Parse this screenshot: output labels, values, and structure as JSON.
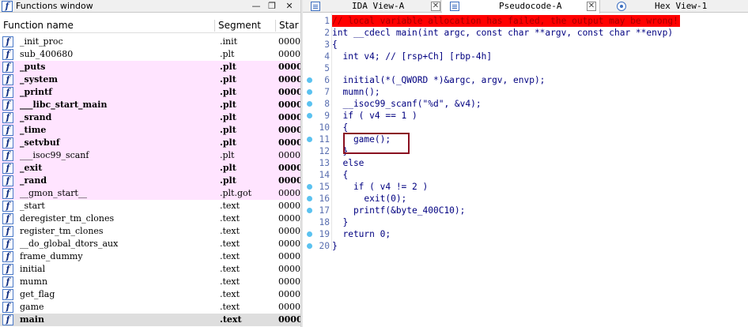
{
  "functions_window": {
    "title": "Functions window",
    "controls": {
      "close": "✕",
      "restore": "❐",
      "minimize": "—"
    },
    "columns": {
      "name": "Function name",
      "segment": "Segment",
      "start": "Star"
    },
    "rows": [
      {
        "name": "_init_proc",
        "segment": ".init",
        "start": "0000",
        "style": "normal"
      },
      {
        "name": "sub_400680",
        "segment": ".plt",
        "start": "0000",
        "style": "normal"
      },
      {
        "name": "_puts",
        "segment": ".plt",
        "start": "0000",
        "style": "pink-bold"
      },
      {
        "name": "_system",
        "segment": ".plt",
        "start": "0000",
        "style": "pink-bold"
      },
      {
        "name": "_printf",
        "segment": ".plt",
        "start": "0000",
        "style": "pink-bold"
      },
      {
        "name": "___libc_start_main",
        "segment": ".plt",
        "start": "0000",
        "style": "pink-bold"
      },
      {
        "name": "_srand",
        "segment": ".plt",
        "start": "0000",
        "style": "pink-bold"
      },
      {
        "name": "_time",
        "segment": ".plt",
        "start": "0000",
        "style": "pink-bold"
      },
      {
        "name": "_setvbuf",
        "segment": ".plt",
        "start": "0000",
        "style": "pink-bold"
      },
      {
        "name": "___isoc99_scanf",
        "segment": ".plt",
        "start": "0000",
        "style": "pink"
      },
      {
        "name": "_exit",
        "segment": ".plt",
        "start": "0000",
        "style": "pink-bold"
      },
      {
        "name": "_rand",
        "segment": ".plt",
        "start": "0000",
        "style": "pink-bold"
      },
      {
        "name": "__gmon_start__",
        "segment": ".plt.got",
        "start": "0000",
        "style": "pink"
      },
      {
        "name": "_start",
        "segment": ".text",
        "start": "0000",
        "style": "normal"
      },
      {
        "name": "deregister_tm_clones",
        "segment": ".text",
        "start": "0000",
        "style": "normal"
      },
      {
        "name": "register_tm_clones",
        "segment": ".text",
        "start": "0000",
        "style": "normal"
      },
      {
        "name": "__do_global_dtors_aux",
        "segment": ".text",
        "start": "0000",
        "style": "normal"
      },
      {
        "name": "frame_dummy",
        "segment": ".text",
        "start": "0000",
        "style": "normal"
      },
      {
        "name": "initial",
        "segment": ".text",
        "start": "0000",
        "style": "normal"
      },
      {
        "name": "mumn",
        "segment": ".text",
        "start": "0000",
        "style": "normal"
      },
      {
        "name": "get_flag",
        "segment": ".text",
        "start": "0000",
        "style": "normal"
      },
      {
        "name": "game",
        "segment": ".text",
        "start": "0000",
        "style": "normal"
      },
      {
        "name": "main",
        "segment": ".text",
        "start": "0000",
        "style": "selected-bold"
      }
    ]
  },
  "tabs": [
    {
      "label": "IDA View-A",
      "active": false
    },
    {
      "label": "Pseudocode-A",
      "active": true
    },
    {
      "label": "Hex View-1",
      "active": false
    }
  ],
  "tab_close_glyph": "✕",
  "pseudocode": {
    "lines": [
      {
        "num": "1",
        "dot": false,
        "text": "// local variable allocation has failed, the output may be wrong!"
      },
      {
        "num": "2",
        "dot": false,
        "text": "int __cdecl main(int argc, const char **argv, const char **envp)"
      },
      {
        "num": "3",
        "dot": false,
        "text": "{"
      },
      {
        "num": "4",
        "dot": false,
        "text": "  int v4; // [rsp+Ch] [rbp-4h]"
      },
      {
        "num": "5",
        "dot": false,
        "text": ""
      },
      {
        "num": "6",
        "dot": true,
        "text": "  initial(*(_QWORD *)&argc, argv, envp);"
      },
      {
        "num": "7",
        "dot": true,
        "text": "  mumn();"
      },
      {
        "num": "8",
        "dot": true,
        "text": "  __isoc99_scanf(\"%d\", &v4);"
      },
      {
        "num": "9",
        "dot": true,
        "text": "  if ( v4 == 1 )"
      },
      {
        "num": "10",
        "dot": false,
        "text": "  {"
      },
      {
        "num": "11",
        "dot": true,
        "text": "    game();"
      },
      {
        "num": "12",
        "dot": false,
        "text": "  }"
      },
      {
        "num": "13",
        "dot": false,
        "text": "  else"
      },
      {
        "num": "14",
        "dot": false,
        "text": "  {"
      },
      {
        "num": "15",
        "dot": true,
        "text": "    if ( v4 != 2 )"
      },
      {
        "num": "16",
        "dot": true,
        "text": "      exit(0);"
      },
      {
        "num": "17",
        "dot": true,
        "text": "    printf(&byte_400C10);"
      },
      {
        "num": "18",
        "dot": false,
        "text": "  }"
      },
      {
        "num": "19",
        "dot": true,
        "text": "  return 0;"
      },
      {
        "num": "20",
        "dot": true,
        "text": "}"
      }
    ]
  }
}
